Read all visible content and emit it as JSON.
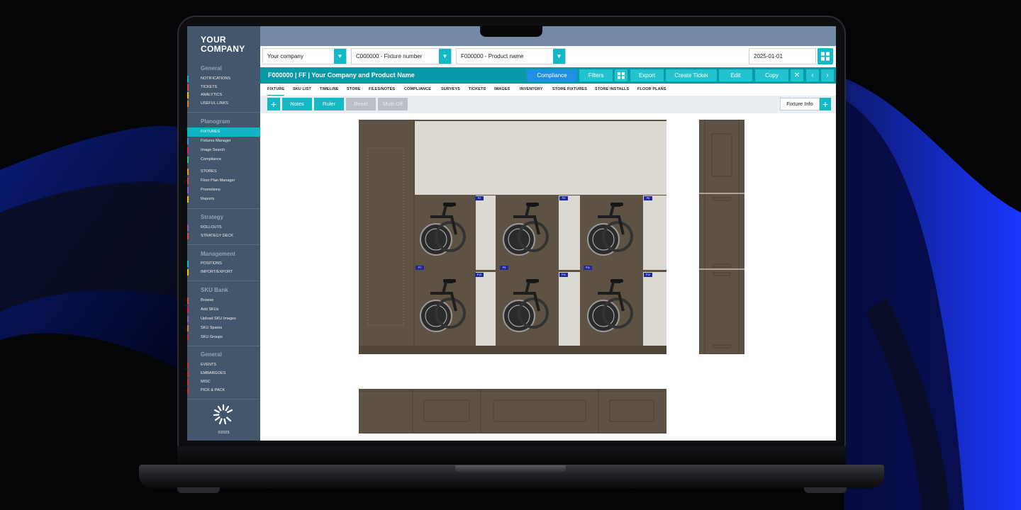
{
  "sidebar": {
    "logo_line1": "YOUR",
    "logo_line2": "COMPANY",
    "sections": [
      {
        "title": "General",
        "items": [
          {
            "label": "NOTIFICATIONS",
            "color": "#14b9c6"
          },
          {
            "label": "TICKETS",
            "color": "#e74c3c"
          },
          {
            "label": "ANALYTICS",
            "color": "#f1c40f"
          },
          {
            "label": "USEFUL LINKS",
            "color": "#e67e22"
          }
        ]
      },
      {
        "title": "Planogram",
        "items": [
          {
            "label": "FIXTURES",
            "color": "#10b5c3"
          },
          {
            "label": "Fixtures Manager",
            "color": "#3498db"
          },
          {
            "label": "Image Search",
            "color": "#e91e63"
          },
          {
            "label": "Compliance",
            "color": "#2ecc71"
          },
          {
            "label": "STORES",
            "color": "#f39c12"
          },
          {
            "label": "Floor Plan Manager",
            "color": "#e74c3c"
          },
          {
            "label": "Promotions",
            "color": "#9b59b6"
          },
          {
            "label": "Reports",
            "color": "#f1c40f"
          }
        ]
      },
      {
        "title": "Strategy",
        "items": [
          {
            "label": "ROLLOUTS",
            "color": "#9b59b6"
          },
          {
            "label": "STRATEGY DECK",
            "color": "#e74c3c"
          }
        ]
      },
      {
        "title": "Management",
        "items": [
          {
            "label": "POSITIONS",
            "color": "#14b9c6"
          },
          {
            "label": "IMPORT/EXPORT",
            "color": "#f1c40f"
          }
        ]
      },
      {
        "title": "SKU Bank",
        "items": [
          {
            "label": "Browse",
            "color": "#e74c3c"
          },
          {
            "label": "Add SKUs",
            "color": "#e91e63"
          },
          {
            "label": "Upload SKU Images",
            "color": "#9b59b6"
          },
          {
            "label": "SKU Spares",
            "color": "#e67e22"
          },
          {
            "label": "SKU Groups",
            "color": "#c0392b"
          }
        ]
      },
      {
        "title": "General",
        "items": [
          {
            "label": "EVENTS",
            "color": "#c0392b"
          },
          {
            "label": "EMBARGOES",
            "color": "#c0392b"
          },
          {
            "label": "MISC",
            "color": "#c0392b"
          },
          {
            "label": "PICK & PACK",
            "color": "#c0392b"
          }
        ]
      }
    ],
    "copyright": "©2025"
  },
  "filters": {
    "company": "Your company",
    "fixture": "C000000 - Fixture number",
    "product": "F000000 - Product name",
    "date": "2025-01-01"
  },
  "titlebar": {
    "title": "F000000 | FF | Your Company and Product Name",
    "buttons": {
      "compliance": "Compliance",
      "filters": "Filters",
      "export": "Export",
      "create_ticket": "Create Ticket",
      "edit": "Edit",
      "copy": "Copy"
    }
  },
  "tabs": [
    "FIXTURE",
    "SKU LIST",
    "TIMELINE",
    "STORE",
    "FILES/NOTES",
    "COMPLIANCE",
    "SURVEYS",
    "TICKETS",
    "IMAGES",
    "INVENTORY",
    "STORE FIXTURES",
    "STORE INSTALLS",
    "FLOOR PLANS"
  ],
  "toolbar": {
    "notes": "Notes",
    "ruler": "Ruler",
    "reset": "Reset",
    "multi": "Multi Off",
    "fixture_info": "Fixture Info"
  },
  "position_tags": [
    "P1",
    "P2",
    "P3",
    "P4",
    "P5",
    "P6",
    "P7",
    "P8",
    "P9",
    "P10",
    "P11",
    "P12"
  ],
  "colors": {
    "accent": "#14b9c6",
    "header": "#0a99a6",
    "sidebar": "#44566b",
    "fixture": "#5e5244"
  }
}
